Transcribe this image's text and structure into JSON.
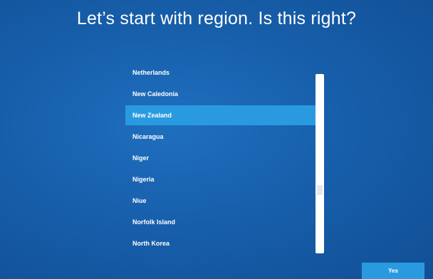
{
  "header": {
    "title": "Let’s start with region. Is this right?"
  },
  "region_list": {
    "items": [
      {
        "label": "Netherlands",
        "selected": false
      },
      {
        "label": "New Caledonia",
        "selected": false
      },
      {
        "label": "New Zealand",
        "selected": true
      },
      {
        "label": "Nicaragua",
        "selected": false
      },
      {
        "label": "Niger",
        "selected": false
      },
      {
        "label": "Nigeria",
        "selected": false
      },
      {
        "label": "Niue",
        "selected": false
      },
      {
        "label": "Norfolk Island",
        "selected": false
      },
      {
        "label": "North Korea",
        "selected": false
      }
    ]
  },
  "footer": {
    "yes_label": "Yes"
  },
  "colors": {
    "background": "#175fab",
    "selection": "#2a9ae0",
    "text": "#ffffff"
  }
}
